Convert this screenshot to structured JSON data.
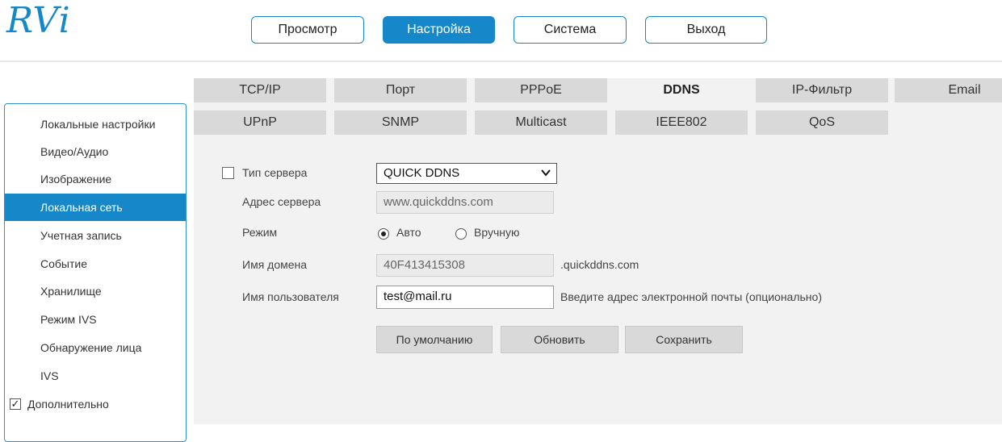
{
  "logo": "RVi",
  "topnav": {
    "items": [
      {
        "label": "Просмотр"
      },
      {
        "label": "Настройка"
      },
      {
        "label": "Система"
      },
      {
        "label": "Выход"
      }
    ],
    "active": "Настройка"
  },
  "sidebar": {
    "items": [
      {
        "label": "Локальные настройки"
      },
      {
        "label": "Видео/Аудио"
      },
      {
        "label": "Изображение"
      },
      {
        "label": "Локальная сеть"
      },
      {
        "label": "Учетная запись"
      },
      {
        "label": "Событие"
      },
      {
        "label": "Хранилище"
      },
      {
        "label": "Режим IVS"
      },
      {
        "label": "Обнаружение лица"
      },
      {
        "label": "IVS"
      },
      {
        "label": "Дополнительно",
        "checked": true
      }
    ],
    "active": "Локальная сеть"
  },
  "tabs": {
    "row1": [
      "TCP/IP",
      "Порт",
      "PPPoE",
      "DDNS",
      "IP-Фильтр",
      "Email"
    ],
    "row2": [
      "UPnP",
      "SNMP",
      "Multicast",
      "IEEE802",
      "QoS"
    ],
    "active": "DDNS"
  },
  "form": {
    "server_type": {
      "label": "Тип сервера",
      "value": "QUICK DDNS",
      "checked": false
    },
    "server_address": {
      "label": "Адрес сервера",
      "value": "www.quickddns.com"
    },
    "mode": {
      "label": "Режим",
      "options": [
        "Авто",
        "Вручную"
      ],
      "selected": "Авто"
    },
    "domain": {
      "label": "Имя домена",
      "value": "40F413415308",
      "suffix": ".quickddns.com"
    },
    "username": {
      "label": "Имя пользователя",
      "value": "test@mail.ru",
      "hint": "Введите адрес электронной почты (опционально)"
    }
  },
  "actions": {
    "default_label": "По умолчанию",
    "refresh_label": "Обновить",
    "save_label": "Сохранить"
  }
}
